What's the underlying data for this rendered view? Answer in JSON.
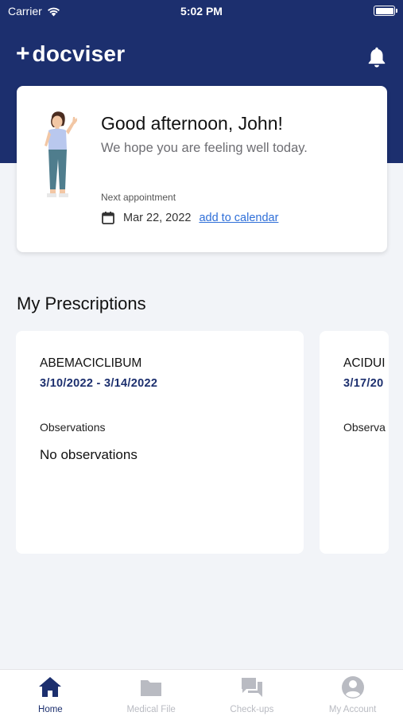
{
  "status_bar": {
    "carrier": "Carrier",
    "time": "5:02 PM"
  },
  "header": {
    "logo_text": "docviser",
    "logo_prefix": "+"
  },
  "greeting": {
    "title": "Good afternoon, John!",
    "subtitle": "We hope you are feeling well today.",
    "next_label": "Next appointment",
    "appointment_date": "Mar 22, 2022",
    "add_calendar_label": "add to calendar"
  },
  "prescriptions": {
    "title": "My Prescriptions",
    "items": [
      {
        "name": "ABEMACICLIBUM",
        "dates": "3/10/2022 - 3/14/2022",
        "observations_label": "Observations",
        "observations": "No observations"
      },
      {
        "name": "ACIDUI",
        "dates": "3/17/20",
        "observations_label": "Observa",
        "observations": ""
      }
    ]
  },
  "tabs": [
    {
      "label": "Home",
      "icon": "home-icon",
      "active": true
    },
    {
      "label": "Medical File",
      "icon": "folder-icon",
      "active": false
    },
    {
      "label": "Check-ups",
      "icon": "chat-icon",
      "active": false
    },
    {
      "label": "My Account",
      "icon": "account-icon",
      "active": false
    }
  ],
  "colors": {
    "brand": "#1c2f6e",
    "link": "#2f6fd8",
    "tab_inactive": "#b9bbc2"
  }
}
